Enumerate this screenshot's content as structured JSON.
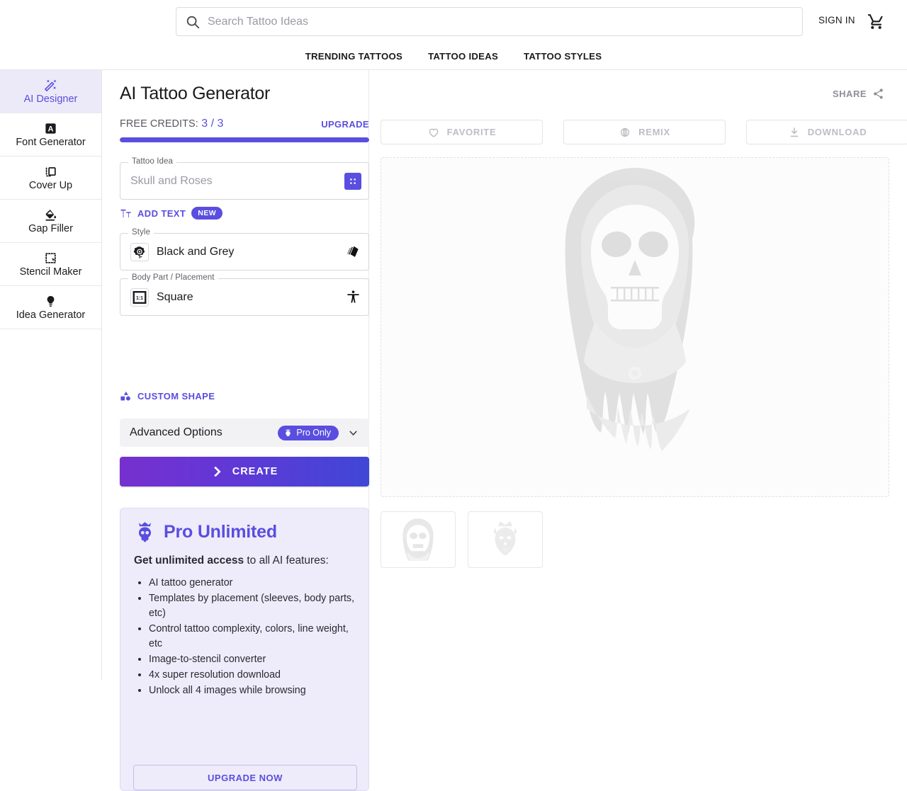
{
  "topbar": {
    "search": {
      "placeholder": "Search Tattoo Ideas",
      "value": "",
      "icon": "search-icon"
    },
    "signin_label": "SIGN IN",
    "cart_icon": "shopping-cart-icon"
  },
  "nav": {
    "tabs": [
      {
        "label": "TRENDING TATTOOS"
      },
      {
        "label": "TATTOO IDEAS"
      },
      {
        "label": "TATTOO STYLES"
      }
    ]
  },
  "sidebar": {
    "items": [
      {
        "label": "AI Designer",
        "icon": "magic-wand-icon",
        "active": true
      },
      {
        "label": "Font Generator",
        "icon": "letter-a-icon",
        "active": false
      },
      {
        "label": "Cover Up",
        "icon": "cover-up-square-icon",
        "active": false
      },
      {
        "label": "Gap Filler",
        "icon": "paint-bucket-icon",
        "active": false
      },
      {
        "label": "Stencil Maker",
        "icon": "dashed-select-icon",
        "active": false
      },
      {
        "label": "Idea Generator",
        "icon": "lightbulb-icon",
        "active": false
      }
    ]
  },
  "main": {
    "page_title": "AI Tattoo Generator",
    "credits": {
      "label": "FREE CREDITS:",
      "count": "3 / 3",
      "used": 3,
      "total": 3,
      "progress_percent": 100,
      "upgrade_label": "UPGRADE"
    },
    "idea_field": {
      "legend": "Tattoo Idea",
      "placeholder": "Skull and Roses",
      "value": "",
      "dice_icon": "dice-icon"
    },
    "add_text": {
      "label": "ADD TEXT",
      "badge": "NEW",
      "icon": "text-format-icon"
    },
    "style_field": {
      "legend": "Style",
      "value": "Black and Grey",
      "thumb_icon": "rose-tattoo-icon",
      "trail_icon": "style-cards-icon"
    },
    "placement_field": {
      "legend": "Body Part / Placement",
      "value": "Square",
      "thumb_icon": "aspect-ratio-1-1-icon",
      "trail_icon": "body-accessibility-icon"
    },
    "custom_shape": {
      "label": "CUSTOM SHAPE",
      "icon": "shapes-icon"
    },
    "advanced": {
      "title": "Advanced Options",
      "badge": "Pro Only",
      "badge_icon": "crowned-skull-icon",
      "chevron_icon": "chevron-down-icon"
    },
    "create_button": {
      "label": "CREATE",
      "icon": "double-chevron-right-icon"
    },
    "pro_card": {
      "icon": "crowned-skull-icon",
      "title": "Pro Unlimited",
      "subtitle_bold": "Get unlimited access",
      "subtitle_rest": " to all AI features:",
      "features": [
        "AI tattoo generator",
        "Templates by placement (sleeves, body parts, etc)",
        "Control tattoo complexity, colors, line weight, etc",
        "Image-to-stencil converter",
        "4x super resolution download",
        "Unlock all 4 images while browsing"
      ],
      "cta_label": "UPGRADE NOW"
    }
  },
  "preview": {
    "share": {
      "label": "SHARE",
      "icon": "share-icon"
    },
    "actions": [
      {
        "label": "FAVORITE",
        "icon": "heart-icon",
        "disabled": true
      },
      {
        "label": "REMIX",
        "icon": "remix-icon",
        "disabled": true
      },
      {
        "label": "DOWNLOAD",
        "icon": "download-icon",
        "disabled": true
      }
    ],
    "canvas": {
      "art_icon": "hooded-skull-tattoo-art"
    },
    "thumbnails": [
      {
        "art_icon": "hooded-skull-thumb"
      },
      {
        "art_icon": "wolf-crown-thumb"
      }
    ]
  },
  "colors": {
    "accent": "#5a4ee0",
    "accent_soft": "#eceaf8",
    "pro_card_bg": "#eeecfa",
    "create_gradient_from": "#7730cf",
    "create_gradient_to": "#4047d6",
    "disabled_text": "#bdbdc5"
  }
}
